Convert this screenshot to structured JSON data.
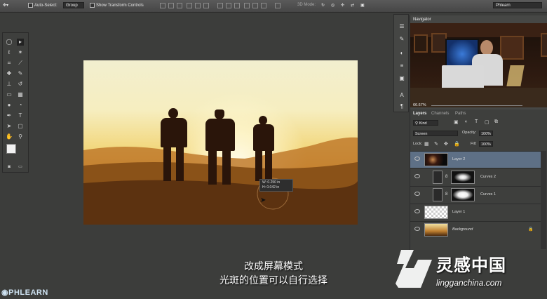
{
  "options_bar": {
    "auto_select_label": "Auto-Select:",
    "auto_select_value": "Group",
    "transform_controls_label": "Show Transform Controls",
    "mode_3d_label": "3D Mode:",
    "workspace_value": "Phlearn"
  },
  "canvas": {
    "measure_w": "W: 0.250 in",
    "measure_h": "H: 0.042 in"
  },
  "navigator": {
    "tab_label": "Navigator",
    "zoom": "66.67%"
  },
  "layers_panel": {
    "tabs": [
      "Layers",
      "Channels",
      "Paths"
    ],
    "kind_label": "Kind",
    "blend_mode": "Screen",
    "opacity_label": "Opacity:",
    "opacity_value": "100%",
    "lock_label": "Lock:",
    "fill_label": "Fill:",
    "fill_value": "100%",
    "layers": [
      {
        "name": "Layer 2",
        "selected": true
      },
      {
        "name": "Curves 2",
        "selected": false
      },
      {
        "name": "Curves 1",
        "selected": false
      },
      {
        "name": "Layer 1",
        "selected": false
      },
      {
        "name": "Background",
        "selected": false
      }
    ]
  },
  "subtitles": {
    "line1": "改成屏幕模式",
    "line2": "光斑的位置可以自行选择"
  },
  "branding": {
    "phlearn_logo": "PHLEARN",
    "watermark_cn": "灵感中国",
    "watermark_url": "lingganchina.com"
  },
  "colors": {
    "app_bg": "#3c3d3b",
    "selected_layer": "#5e7086",
    "sunset_orange": "#e2a640"
  }
}
